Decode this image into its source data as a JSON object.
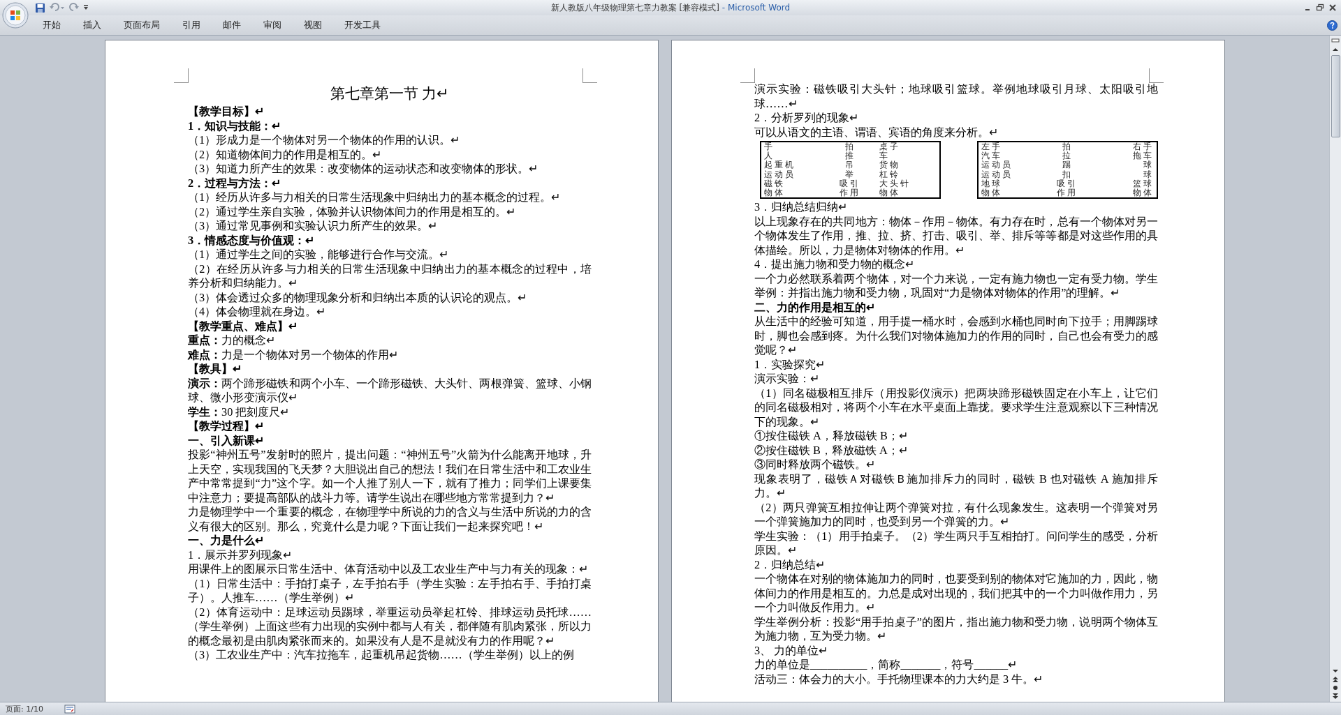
{
  "window": {
    "document_title": "新人教版八年级物理第七章力教案 [兼容模式]",
    "app_name": "- Microsoft Word"
  },
  "ribbon_tabs": [
    {
      "label": "开始",
      "selected": false
    },
    {
      "label": "插入",
      "selected": false
    },
    {
      "label": "页面布局",
      "selected": false
    },
    {
      "label": "引用",
      "selected": false
    },
    {
      "label": "邮件",
      "selected": false
    },
    {
      "label": "审阅",
      "selected": false
    },
    {
      "label": "视图",
      "selected": false
    },
    {
      "label": "开发工具",
      "selected": false
    }
  ],
  "pages": [
    {
      "blocks": [
        {
          "kind": "title",
          "text": "第七章第一节  力↵"
        },
        {
          "kind": "heading",
          "text": "【教学目标】↵"
        },
        {
          "kind": "heading",
          "text": "1．知识与技能：↵"
        },
        {
          "kind": "text",
          "text": "（1）形成力是一个物体对另一个物体的作用的认识。↵"
        },
        {
          "kind": "text",
          "text": "（2）知道物体间力的作用是相互的。↵"
        },
        {
          "kind": "text",
          "text": "（3）知道力所产生的效果：改变物体的运动状态和改变物体的形状。↵"
        },
        {
          "kind": "heading",
          "text": "2．过程与方法：↵"
        },
        {
          "kind": "text",
          "text": "（1）经历从许多与力相关的日常生活现象中归纳出力的基本概念的过程。↵"
        },
        {
          "kind": "text",
          "text": "（2）通过学生亲自实验，体验并认识物体间力的作用是相互的。↵"
        },
        {
          "kind": "text",
          "text": "（3）通过常见事例和实验认识力所产生的效果。↵"
        },
        {
          "kind": "heading",
          "text": "3．情感态度与价值观：↵"
        },
        {
          "kind": "text",
          "text": "（1）通过学生之间的实验，能够进行合作与交流。↵"
        },
        {
          "kind": "text",
          "text": "（2）在经历从许多与力相关的日常生活现象中归纳出力的基本概念的过程中，培养分析和归纳能力。↵"
        },
        {
          "kind": "text",
          "text": "（3）体会透过众多的物理现象分析和归纳出本质的认识论的观点。↵"
        },
        {
          "kind": "text",
          "text": "（4）体会物理就在身边。↵"
        },
        {
          "kind": "heading",
          "text": "【教学重点、难点】↵"
        },
        {
          "kind": "text",
          "text": "**重点：**力的概念↵"
        },
        {
          "kind": "text",
          "text": "**难点：**力是一个物体对另一个物体的作用↵"
        },
        {
          "kind": "heading",
          "text": "【教具】↵"
        },
        {
          "kind": "text",
          "text": "**演示：**两个蹄形磁铁和两个小车、一个蹄形磁铁、大头针、两根弹簧、篮球、小钢球、微小形变演示仪↵"
        },
        {
          "kind": "text",
          "text": "**学生：**30 把刻度尺↵"
        },
        {
          "kind": "heading",
          "text": "【教学过程】↵"
        },
        {
          "kind": "heading",
          "text": "一、引入新课↵"
        },
        {
          "kind": "text",
          "text": "投影“神州五号”发射时的照片，提出问题：“神州五号”火箭为什么能离开地球，升上天空，实现我国的飞天梦？大胆说出自己的想法！我们在日常生活中和工农业生产中常常提到“力”这个字。如一个人推了别人一下，就有了推力；同学们上课要集中注意力；要提高部队的战斗力等。请学生说出在哪些地方常常提到力？↵"
        },
        {
          "kind": "text",
          "text": "力是物理学中一个重要的概念，在物理学中所说的力的含义与生活中所说的力的含义有很大的区别。那么，究竟什么是力呢？下面让我们一起来探究吧！↵"
        },
        {
          "kind": "heading",
          "text": "一、力是什么↵"
        },
        {
          "kind": "text",
          "text": "1．展示并罗列现象↵"
        },
        {
          "kind": "text",
          "text": "用课件上的图展示日常生活中、体育活动中以及工农业生产中与力有关的现象：↵"
        },
        {
          "kind": "text",
          "text": "（1）日常生活中：手拍打桌子，左手拍右手（学生实验：左手拍右手、手拍打桌子）。人推车……（学生举例）↵"
        },
        {
          "kind": "text",
          "text": "（2）体育运动中：足球运动员踢球，举重运动员举起杠铃、排球运动员托球……（学生举例）上面这些有力出现的实例中都与人有关，都伴随有肌肉紧张，所以力的概念最初是由肌肉紧张而来的。如果没有人是不是就没有力的作用呢？↵"
        },
        {
          "kind": "text",
          "text": "（3）工农业生产中：汽车拉拖车，起重机吊起货物……（学生举例）以上的例"
        }
      ]
    },
    {
      "blocks": [
        {
          "kind": "text",
          "text": "演示实验：磁铁吸引大头针；地球吸引篮球。举例地球吸引月球、太阳吸引地球……↵"
        },
        {
          "kind": "text",
          "text": "2．分析罗列的现象↵"
        },
        {
          "kind": "text",
          "text": "可以从语文的主语、谓语、宾语的角度来分析。↵"
        },
        {
          "kind": "tables",
          "tables": [
            {
              "rows": [
                [
                  "手",
                  "拍",
                  "桌子"
                ],
                [
                  "人",
                  "推",
                  "车"
                ],
                [
                  "起重机",
                  "吊",
                  "货物"
                ],
                [
                  "运动员",
                  "举",
                  "杠铃"
                ],
                [
                  "磁铁",
                  "吸引",
                  "大头针"
                ],
                [
                  "物体",
                  "作用",
                  "物体"
                ]
              ]
            },
            {
              "rows": [
                [
                  "左手",
                  "拍",
                  "右手"
                ],
                [
                  "汽车",
                  "拉",
                  "拖车"
                ],
                [
                  "运动员",
                  "踢",
                  "球"
                ],
                [
                  "运动员",
                  "扣",
                  "球"
                ],
                [
                  "地球",
                  "吸引",
                  "篮球"
                ],
                [
                  "物体",
                  "作用",
                  "物体"
                ]
              ]
            }
          ]
        },
        {
          "kind": "text",
          "text": "3．归纳总结归纳↵"
        },
        {
          "kind": "text",
          "text": "以上现象存在的共同地方：物体－作用－物体。有力存在时，总有一个物体对另一个物体发生了作用，推、拉、挤、打击、吸引、举、排斥等等都是对这些作用的具体描绘。所以，力是物体对物体的作用。↵"
        },
        {
          "kind": "text",
          "text": "4．提出施力物和受力物的概念↵"
        },
        {
          "kind": "text",
          "text": "一个力必然联系着两个物体，对一个力来说，一定有施力物也一定有受力物。学生举例：并指出施力物和受力物，巩固对“力是物体对物体的作用”的理解。↵"
        },
        {
          "kind": "heading",
          "text": "二、力的作用是相互的↵"
        },
        {
          "kind": "text",
          "text": "从生活中的经验可知道，用手提一桶水时，会感到水桶也同时向下拉手；用脚踢球时，脚也会感到疼。为什么我们对物体施加力的作用的同时，自己也会有受力的感觉呢？↵"
        },
        {
          "kind": "text",
          "text": "1．实验探究↵"
        },
        {
          "kind": "text",
          "text": "演示实验：↵"
        },
        {
          "kind": "text",
          "text": "（1）同名磁极相互排斥（用投影仪演示）把两块蹄形磁铁固定在小车上，让它们的同名磁极相对，将两个小车在水平桌面上靠拢。要求学生注意观察以下三种情况下的现象。↵"
        },
        {
          "kind": "text",
          "text": "①按住磁铁 A，释放磁铁 B；↵"
        },
        {
          "kind": "text",
          "text": "②按住磁铁 B，释放磁铁 A；↵"
        },
        {
          "kind": "text",
          "text": "③同时释放两个磁铁。↵"
        },
        {
          "kind": "text",
          "text": "现象表明了，磁铁Ａ对磁铁Ｂ施加排斥力的同时，磁铁 B 也对磁铁 A 施加排斥力。↵"
        },
        {
          "kind": "text",
          "text": "（2）两只弹簧互相拉伸让两个弹簧对拉，有什么现象发生。这表明一个弹簧对另一个弹簧施加力的同时，也受到另一个弹簧的力。↵"
        },
        {
          "kind": "text",
          "text": "学生实验：（1）用手拍桌子。（2）学生两只手互相拍打。问问学生的感受，分析原因。↵"
        },
        {
          "kind": "text",
          "text": "2．归纳总结↵"
        },
        {
          "kind": "text",
          "text": "一个物体在对别的物体施加力的同时，也要受到别的物体对它施加的力，因此，物体间力的作用是相互的。力总是成对出现的，我们把其中的一个力叫做作用力，另一个力叫做反作用力。↵"
        },
        {
          "kind": "text",
          "text": "学生举例分析：投影“用手拍桌子”的图片，指出施力物和受力物，说明两个物体互为施力物，互为受力物。↵"
        },
        {
          "kind": "text",
          "text": "3、  力的单位↵"
        },
        {
          "kind": "text",
          "text": "力的单位是__________，简称_______，符号______↵"
        },
        {
          "kind": "text",
          "text": "活动三：体会力的大小。手托物理课本的力大约是 3 牛。↵"
        }
      ]
    }
  ],
  "status_bar": {
    "page": "页面: 1/10"
  }
}
